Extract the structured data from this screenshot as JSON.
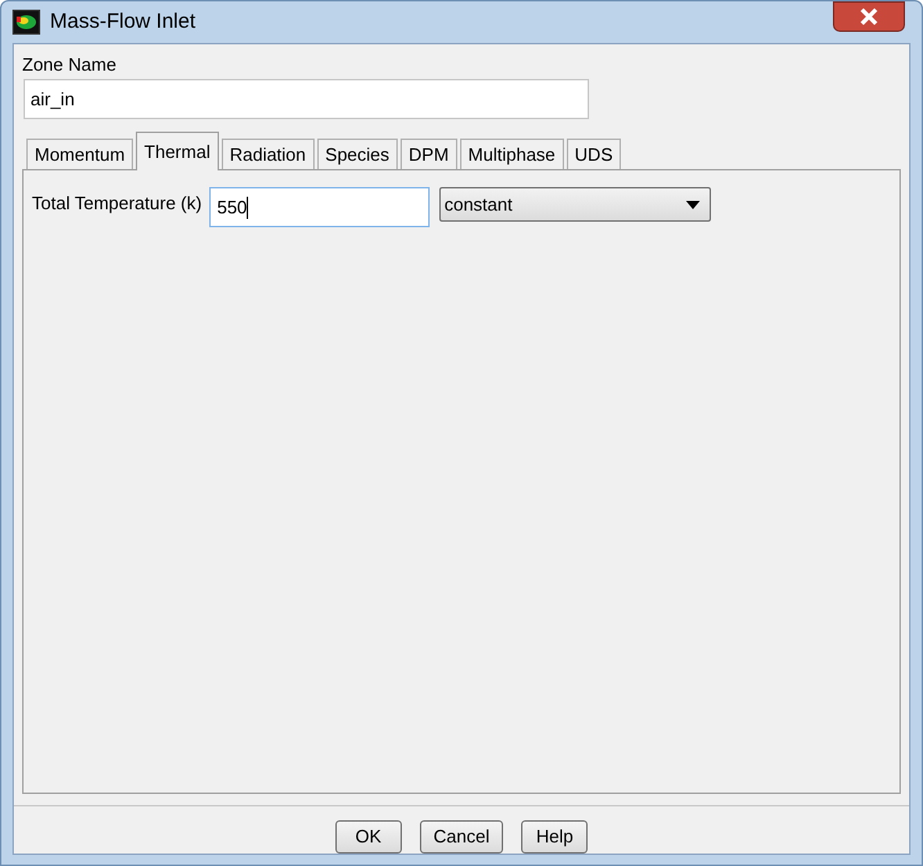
{
  "window": {
    "title": "Mass-Flow Inlet"
  },
  "zone_name": {
    "label": "Zone Name",
    "value": "air_in"
  },
  "tabs": [
    {
      "label": "Momentum",
      "selected": false
    },
    {
      "label": "Thermal",
      "selected": true
    },
    {
      "label": "Radiation",
      "selected": false
    },
    {
      "label": "Species",
      "selected": false
    },
    {
      "label": "DPM",
      "selected": false
    },
    {
      "label": "Multiphase",
      "selected": false
    },
    {
      "label": "UDS",
      "selected": false
    }
  ],
  "thermal": {
    "label": "Total Temperature (k)",
    "value": "550",
    "method": "constant"
  },
  "buttons": [
    "OK",
    "Cancel",
    "Help"
  ]
}
